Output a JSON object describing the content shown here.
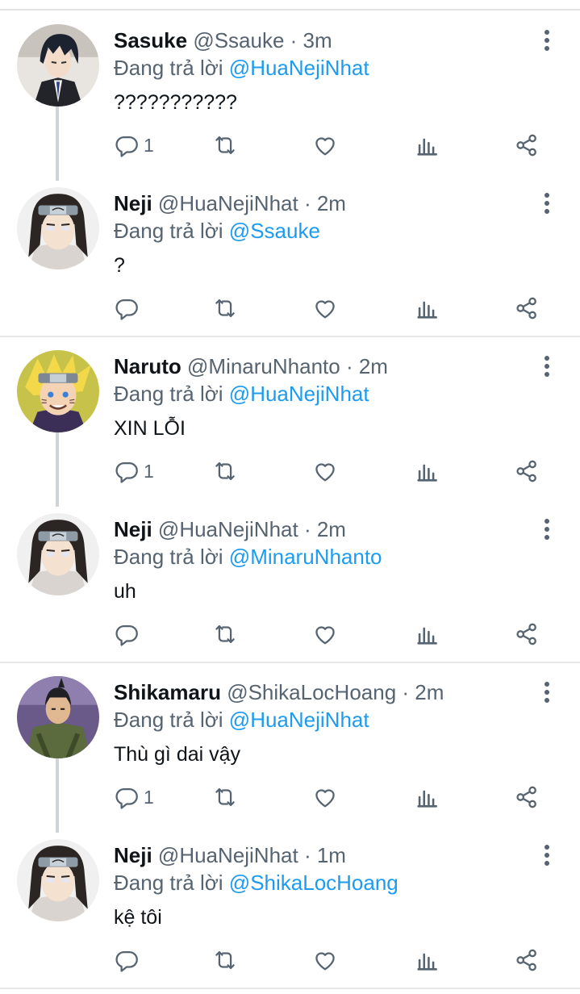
{
  "reply_prefix": "Đang trả lời",
  "colors": {
    "mention": "#1d9bf0",
    "meta": "#566370",
    "name": "#0f1419",
    "thread": "#d0d4d8"
  },
  "tweets": [
    {
      "name": "Sasuke",
      "handle": "@Ssauke",
      "time": "· 3m",
      "reply_to": "@HuaNejiNhat",
      "text": "???????????",
      "reply_count": "1",
      "avatar": "sasuke-avatar"
    },
    {
      "name": "Neji",
      "handle": "@HuaNejiNhat",
      "time": "· 2m",
      "reply_to": "@Ssauke",
      "text": "?",
      "reply_count": "",
      "avatar": "neji-avatar"
    },
    {
      "name": "Naruto",
      "handle": "@MinaruNhanto",
      "time": "· 2m",
      "reply_to": "@HuaNejiNhat",
      "text": "XIN LỖI",
      "reply_count": "1",
      "avatar": "naruto-avatar"
    },
    {
      "name": "Neji",
      "handle": "@HuaNejiNhat",
      "time": "· 2m",
      "reply_to": "@MinaruNhanto",
      "text": "uh",
      "reply_count": "",
      "avatar": "neji-avatar"
    },
    {
      "name": "Shikamaru",
      "handle": "@ShikaLocHoang",
      "time": "· 2m",
      "reply_to": "@HuaNejiNhat",
      "text": "Thù gì dai vậy",
      "reply_count": "1",
      "avatar": "shikamaru-avatar"
    },
    {
      "name": "Neji",
      "handle": "@HuaNejiNhat",
      "time": "· 1m",
      "reply_to": "@ShikaLocHoang",
      "text": "kệ tôi",
      "reply_count": "",
      "avatar": "neji-avatar"
    }
  ]
}
